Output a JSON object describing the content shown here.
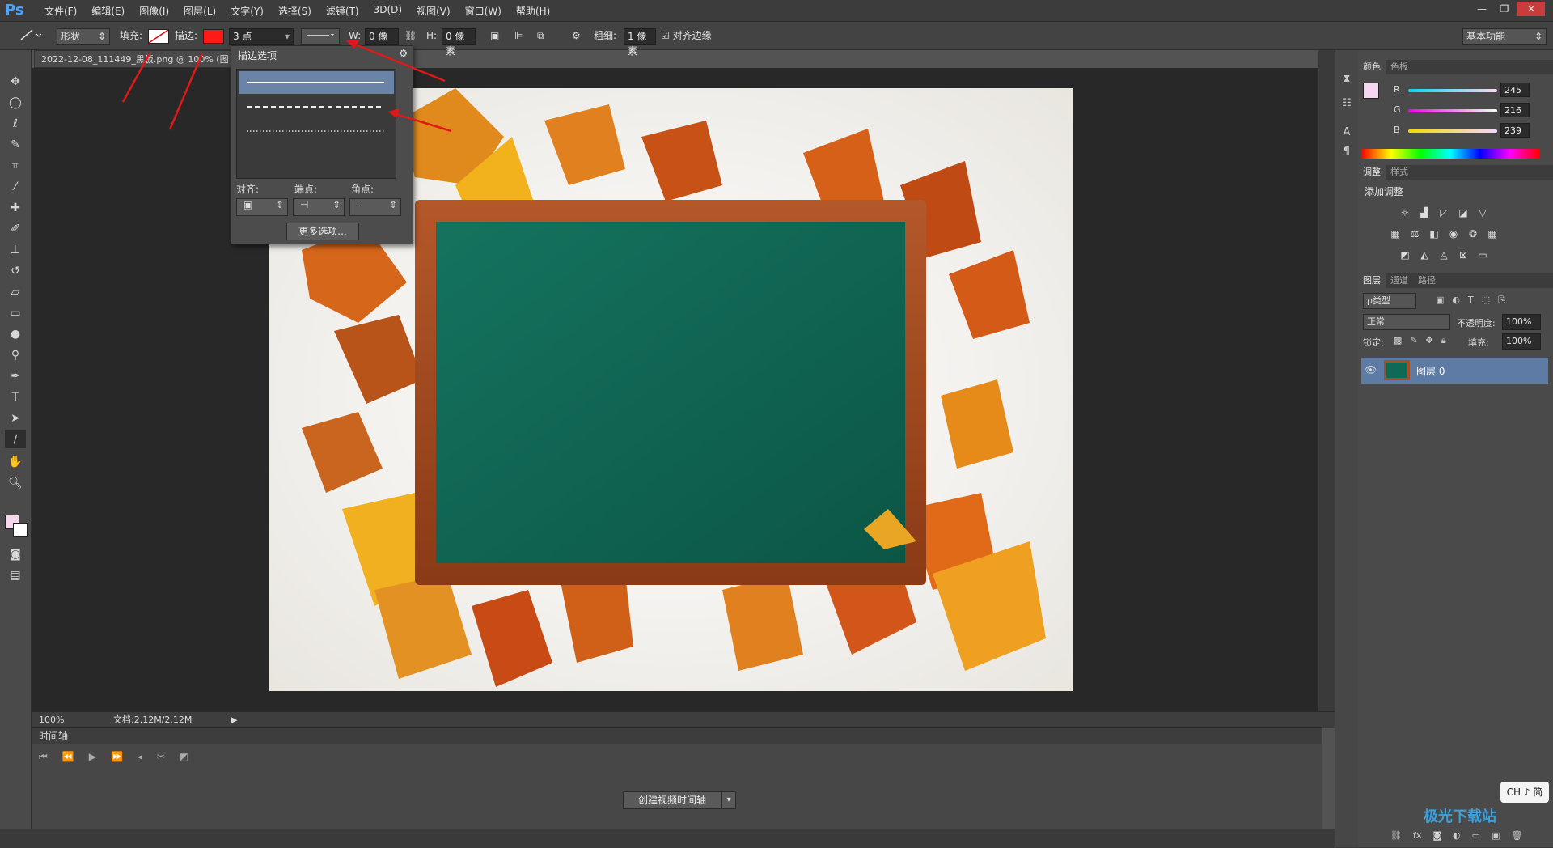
{
  "app": {
    "logo": "Ps"
  },
  "menu": [
    "文件(F)",
    "编辑(E)",
    "图像(I)",
    "图层(L)",
    "文字(Y)",
    "选择(S)",
    "滤镜(T)",
    "3D(D)",
    "视图(V)",
    "窗口(W)",
    "帮助(H)"
  ],
  "window_controls": [
    "—",
    "❐",
    "✕"
  ],
  "options": {
    "mode": "形状",
    "fill_label": "填充:",
    "stroke_label": "描边:",
    "stroke_width": "3 点",
    "w_label": "W:",
    "w_value": "0 像素",
    "h_label": "H:",
    "h_value": "0 像素",
    "weight_label": "粗细:",
    "weight_value": "1 像素",
    "align_edges": "对齐边缘",
    "workspace": "基本功能",
    "fill_color": "#ffffff",
    "stroke_color": "#ff1a1a"
  },
  "document": {
    "tab_title": "2022-12-08_111449_黑板.png @ 100% (图",
    "zoom": "100%",
    "doc_size": "文档:2.12M/2.12M"
  },
  "stroke_popup": {
    "title": "描边选项",
    "align_label": "对齐:",
    "caps_label": "端点:",
    "corners_label": "角点:",
    "more_button": "更多选项..."
  },
  "timeline": {
    "title": "时间轴",
    "create_button": "创建视频时间轴"
  },
  "panels": {
    "color_tabs": [
      "颜色",
      "色板"
    ],
    "rgb": {
      "r_label": "R",
      "r": "245",
      "g_label": "G",
      "g": "216",
      "b_label": "B",
      "b": "239"
    },
    "fg_color": "#f5d8ef",
    "adjust_tabs": [
      "调整",
      "样式"
    ],
    "adjust_title": "添加调整",
    "layer_tabs": [
      "图层",
      "通道",
      "路径"
    ],
    "kind_filter": "ρ类型",
    "blend_mode": "正常",
    "opacity_label": "不透明度:",
    "opacity": "100%",
    "lock_label": "锁定:",
    "fill_label": "填充:",
    "fill": "100%",
    "layer_name": "图层 0"
  },
  "ime_badge": "CH ♪ 简",
  "watermark": "极光下载站"
}
